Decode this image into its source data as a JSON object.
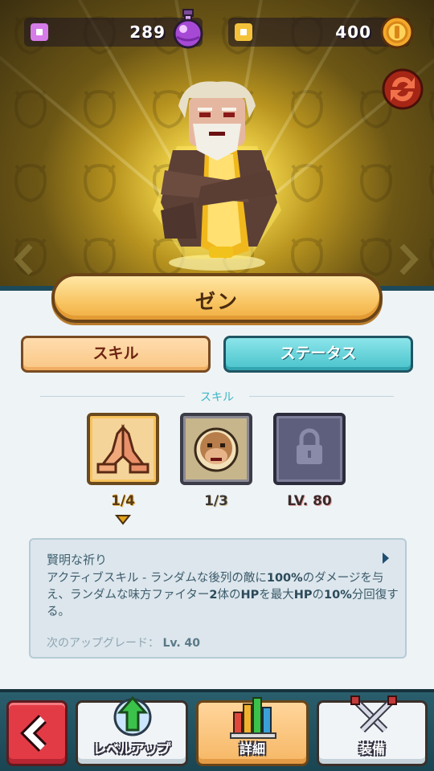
{
  "currency": {
    "gems": "289",
    "coins": "400"
  },
  "character": {
    "name": "ゼン"
  },
  "tabs": {
    "skill": "スキル",
    "status": "ステータス"
  },
  "skills_section": {
    "title": "スキル",
    "slots": [
      {
        "icon": "praying-hands-icon",
        "level": "1/4",
        "selected": true
      },
      {
        "icon": "monkey-face-icon",
        "level": "1/3",
        "selected": false
      },
      {
        "icon": "lock-icon",
        "level": "LV. 80",
        "locked": true
      }
    ]
  },
  "description": {
    "title": "賢明な祈り",
    "body_parts": [
      "アクティブスキル - ランダムな後列の敵に",
      "100%",
      "のダメージを与え、ランダムな味方ファイター",
      "2",
      "体の",
      "HP",
      "を最大",
      "HP",
      "の",
      "10%",
      "分回復する。"
    ],
    "upgrade_label": "次のアップグレード：",
    "upgrade_value": "Lv. 40"
  },
  "bottom_nav": {
    "levelup": "レベルアップ",
    "detail": "詳細",
    "equip": "装備"
  },
  "colors": {
    "gem_accent": "#d67ce8",
    "coin_accent": "#f4c23a",
    "status_tab": "#49c2cb",
    "back_button": "#e33b46"
  }
}
